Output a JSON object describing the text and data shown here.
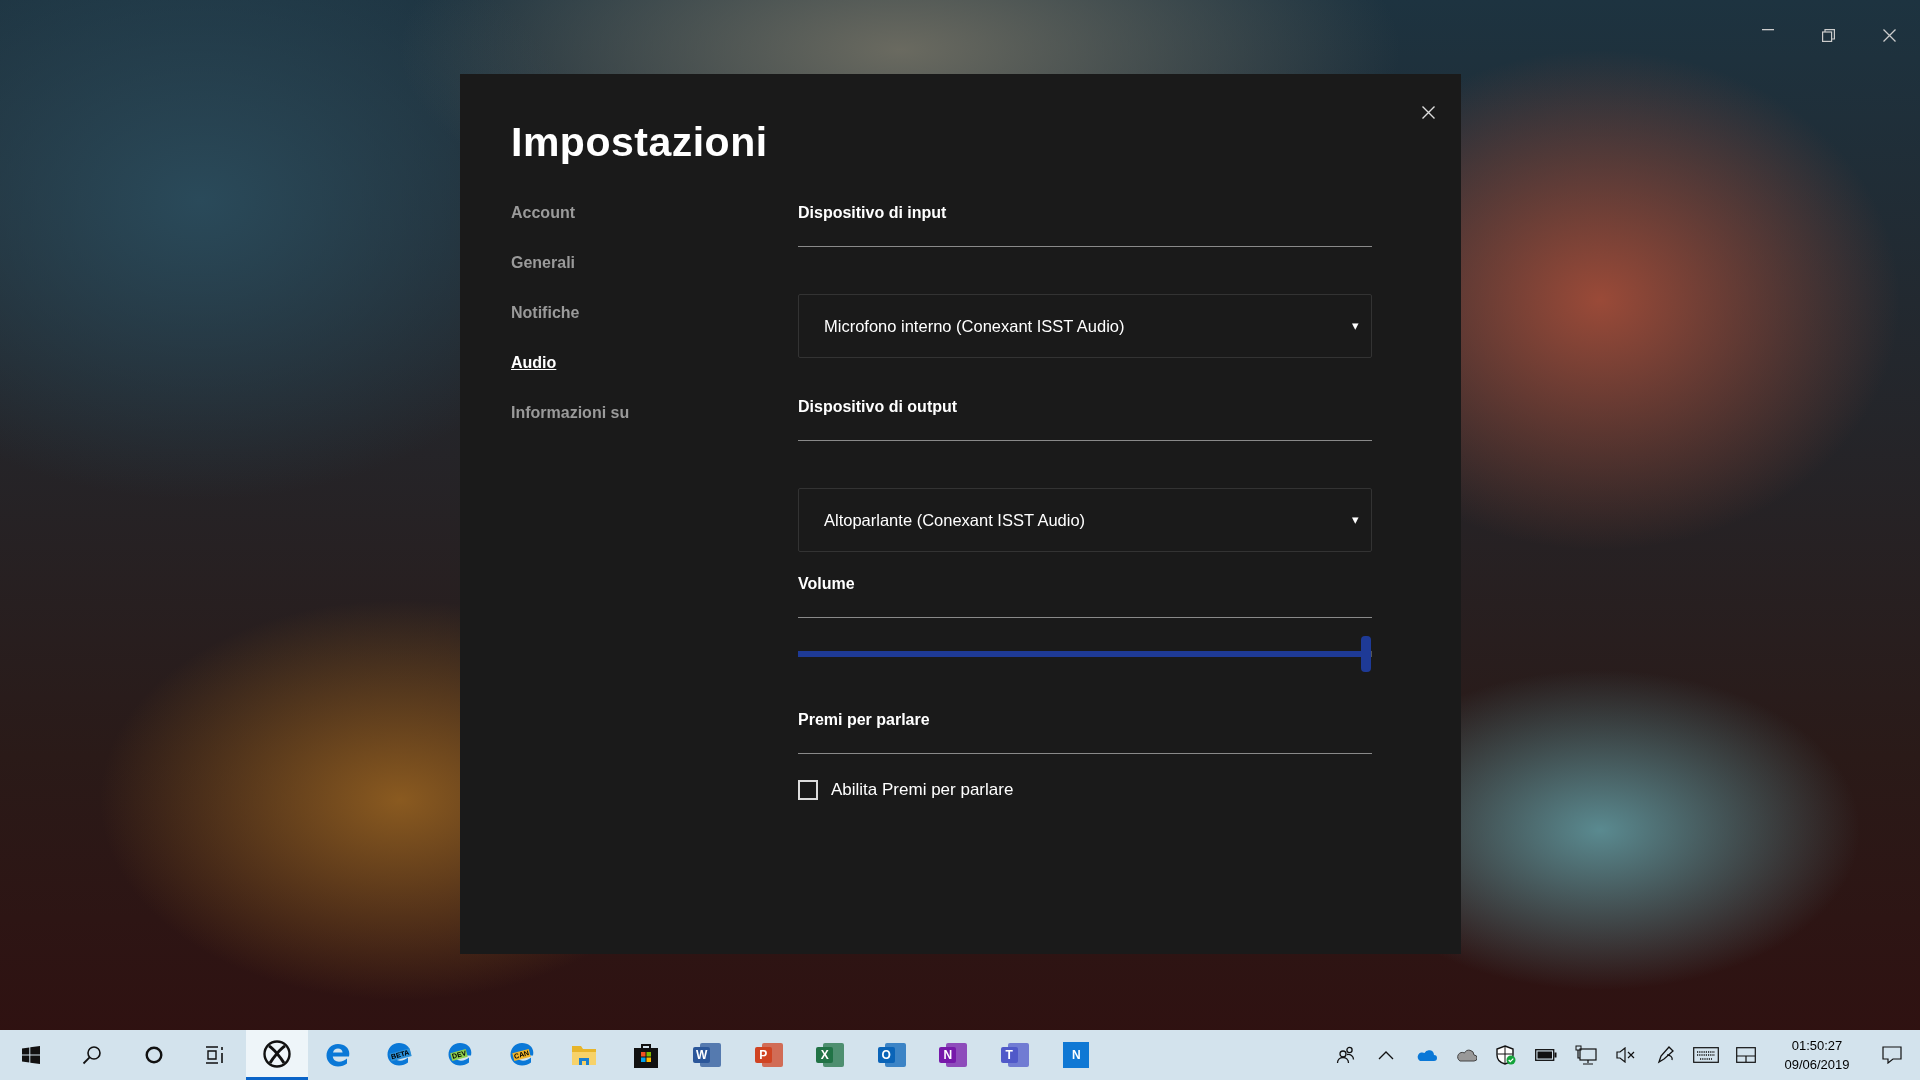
{
  "dialog": {
    "title": "Impostazioni",
    "nav": [
      {
        "label": "Account",
        "selected": false
      },
      {
        "label": "Generali",
        "selected": false
      },
      {
        "label": "Notifiche",
        "selected": false
      },
      {
        "label": "Audio",
        "selected": true
      },
      {
        "label": "Informazioni su",
        "selected": false
      }
    ],
    "sections": [
      {
        "kind": "dropdown",
        "heading": "Dispositivo di input",
        "value": "Microfono interno (Conexant ISST Audio)",
        "arrow": "▾"
      },
      {
        "kind": "dropdown",
        "heading": "Dispositivo di output",
        "value": "Altoparlante (Conexant ISST Audio)",
        "arrow": "▾"
      },
      {
        "kind": "slider",
        "heading": "Volume",
        "level": 0.99
      },
      {
        "kind": "checkbox",
        "heading": "Premi per parlare",
        "label": "Abilita Premi per parlare",
        "checked": false
      }
    ]
  },
  "taskbar": {
    "apps": [
      {
        "kind": "start",
        "selected": false
      },
      {
        "kind": "search",
        "selected": false
      },
      {
        "kind": "cortana",
        "selected": false
      },
      {
        "kind": "taskview",
        "selected": false
      },
      {
        "kind": "xbox",
        "selected": true
      },
      {
        "kind": "edge",
        "selected": false
      },
      {
        "kind": "edge-badge",
        "badge": "BETA",
        "color": "#2a8fd8",
        "selected": false
      },
      {
        "kind": "edge-badge",
        "badge": "DEV",
        "color": "#8fd14f",
        "selected": false
      },
      {
        "kind": "edge-badge",
        "badge": "CAN",
        "color": "#f3b52a",
        "selected": false
      },
      {
        "kind": "folder",
        "selected": false
      },
      {
        "kind": "store",
        "selected": false
      },
      {
        "kind": "office",
        "letter": "W",
        "color": "#2b579a",
        "selected": false
      },
      {
        "kind": "office",
        "letter": "P",
        "color": "#d04423",
        "selected": false
      },
      {
        "kind": "office",
        "letter": "X",
        "color": "#217346",
        "selected": false
      },
      {
        "kind": "office",
        "letter": "O",
        "color": "#0a64b8",
        "selected": false
      },
      {
        "kind": "office",
        "letter": "N",
        "color": "#7719aa",
        "selected": false
      },
      {
        "kind": "office",
        "letter": "T",
        "color": "#5059c9",
        "selected": false
      },
      {
        "kind": "tile",
        "letter": "N",
        "color": "#0f78d4",
        "selected": false
      }
    ],
    "clock": {
      "time": "01:50:27",
      "date": "09/06/2019"
    }
  }
}
